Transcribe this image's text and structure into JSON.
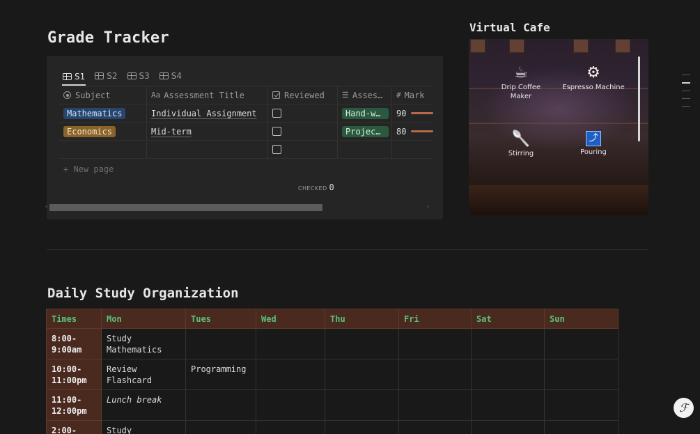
{
  "grade_tracker": {
    "title": "Grade Tracker",
    "tabs": [
      {
        "label": "S1",
        "active": true
      },
      {
        "label": "S2"
      },
      {
        "label": "S3"
      },
      {
        "label": "S4"
      }
    ],
    "columns": [
      "Subject",
      "Assessment Title",
      "Reviewed",
      "Asses…",
      "Mark"
    ],
    "column_prefixes": {
      "title": "Aa",
      "mark": "#"
    },
    "rows": [
      {
        "subject": "Mathematics",
        "title": "Individual Assignment",
        "reviewed": false,
        "assessment": "Hand-w…",
        "mark": "90"
      },
      {
        "subject": "Economics",
        "title": "Mid-term",
        "reviewed": false,
        "assessment": "Projec…",
        "mark": "80"
      },
      {
        "subject": "",
        "title": "",
        "reviewed": false,
        "assessment": "",
        "mark": ""
      }
    ],
    "new_page": "+ New page",
    "checked_label": "CHECKED",
    "checked_value": "0"
  },
  "cafe": {
    "title": "Virtual Cafe",
    "items": [
      {
        "label": "Drip Coffee Maker",
        "icon": "coffee-cup-icon"
      },
      {
        "label": "Espresso Machine",
        "icon": "gear-icon"
      },
      {
        "label": "Stirring",
        "icon": "spoon-icon"
      },
      {
        "label": "Pouring",
        "icon": "pouring-icon"
      }
    ]
  },
  "schedule": {
    "title": "Daily Study Organization",
    "headers": [
      "Times",
      "Mon",
      "Tues",
      "Wed",
      "Thu",
      "Fri",
      "Sat",
      "Sun"
    ],
    "rows": [
      {
        "time": "8:00-9:00am",
        "mon": "Study Mathematics",
        "tues": ""
      },
      {
        "time": "10:00-11:00pm",
        "mon": "Review Flashcard",
        "tues": "Programming"
      },
      {
        "time": "11:00-12:00pm",
        "mon": "Lunch break",
        "tues": ""
      },
      {
        "time": "2:00-",
        "mon": "Study",
        "tues": ""
      }
    ]
  },
  "colors": {
    "background": "#191919",
    "header_bg": "#4a2a1e",
    "header_text": "#5bbf7a",
    "tag_blue": "#28456c",
    "tag_brown": "#89632a",
    "tag_green": "#2b593f",
    "mark_bar": "#b66a4a"
  }
}
